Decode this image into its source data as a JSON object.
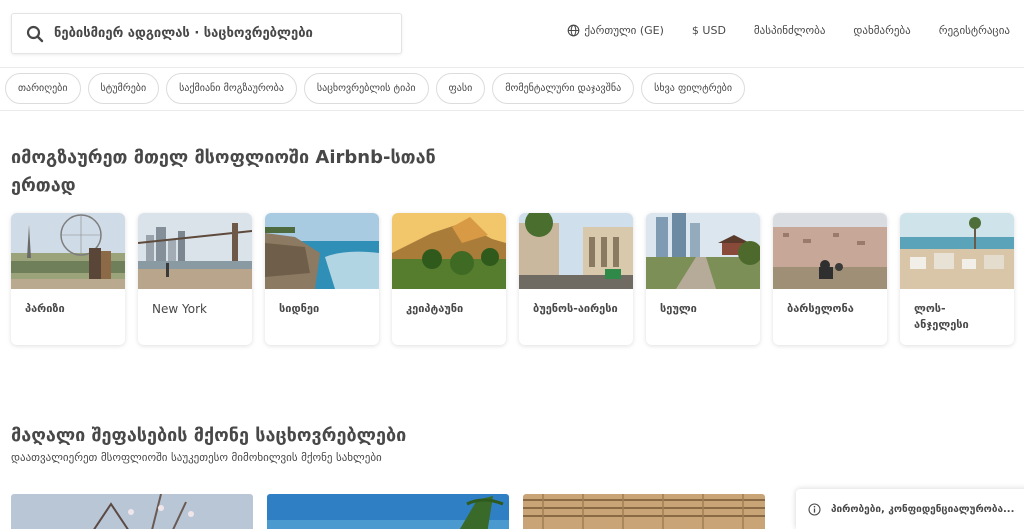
{
  "header": {
    "search_placeholder": "ნებისმიერ ადგილას · საცხოვრებლები",
    "language": "ქართული (GE)",
    "currency": "$ USD",
    "host": "მასპინძლობა",
    "help": "დახმარება",
    "signup": "რეგისტრაცია"
  },
  "filters": [
    "თარიღები",
    "სტუმრები",
    "საქმიანი მოგზაურობა",
    "საცხოვრებლის ტიპი",
    "ფასი",
    "მომენტალური დაჯავშნა",
    "სხვა ფილტრები"
  ],
  "section1": {
    "title": "იმოგზაურეთ მთელ მსოფლიოში Airbnb-სთან ერთად",
    "cities": [
      {
        "name": "პარიზი"
      },
      {
        "name": "New York"
      },
      {
        "name": "სიდნეი"
      },
      {
        "name": "კეიპტაუნი"
      },
      {
        "name": "ბუენოს-აირესი"
      },
      {
        "name": "სეული"
      },
      {
        "name": "ბარსელონა"
      },
      {
        "name": "ლოს-ანჯელესი"
      }
    ]
  },
  "section2": {
    "title": "მაღალი შეფასების მქონე საცხოვრებლები",
    "subtitle": "დაათვალიერეთ მსოფლიოში საუკეთესო მიმოხილვის მქონე სახლები"
  },
  "policy": {
    "text": "პირობები, კონფიდენციალურობა..."
  },
  "colors": {
    "text": "#484848",
    "border": "#ebebeb"
  }
}
